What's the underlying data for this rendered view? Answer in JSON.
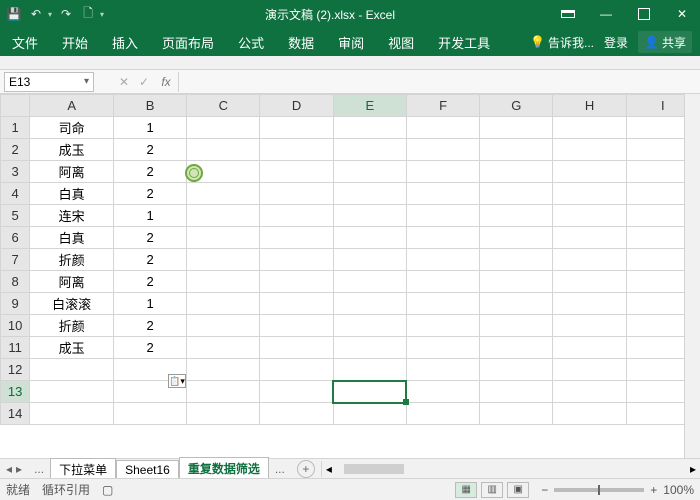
{
  "window": {
    "title": "演示文稿 (2).xlsx - Excel"
  },
  "qat": {
    "save": "💾",
    "undo": "↶",
    "redo": "↷",
    "new": "🗋"
  },
  "tabs": {
    "file": "文件",
    "home": "开始",
    "insert": "插入",
    "layout": "页面布局",
    "formulas": "公式",
    "data": "数据",
    "review": "审阅",
    "view": "视图",
    "dev": "开发工具",
    "tell": "告诉我...",
    "login": "登录",
    "share": "共享"
  },
  "namebox": "E13",
  "fx_label": "fx",
  "columns": [
    "A",
    "B",
    "C",
    "D",
    "E",
    "F",
    "G",
    "H",
    "I"
  ],
  "rows": [
    {
      "n": "1",
      "A": "司命",
      "B": "1"
    },
    {
      "n": "2",
      "A": "成玉",
      "B": "2"
    },
    {
      "n": "3",
      "A": "阿离",
      "B": "2"
    },
    {
      "n": "4",
      "A": "白真",
      "B": "2"
    },
    {
      "n": "5",
      "A": "连宋",
      "B": "1"
    },
    {
      "n": "6",
      "A": "白真",
      "B": "2"
    },
    {
      "n": "7",
      "A": "折颜",
      "B": "2"
    },
    {
      "n": "8",
      "A": "阿离",
      "B": "2"
    },
    {
      "n": "9",
      "A": "白滚滚",
      "B": "1"
    },
    {
      "n": "10",
      "A": "折颜",
      "B": "2"
    },
    {
      "n": "11",
      "A": "成玉",
      "B": "2"
    },
    {
      "n": "12",
      "A": "",
      "B": ""
    },
    {
      "n": "13",
      "A": "",
      "B": ""
    },
    {
      "n": "14",
      "A": "",
      "B": ""
    }
  ],
  "sheet_tabs": {
    "prev": "...",
    "t1": "下拉菜单",
    "t2": "Sheet16",
    "t3": "重复数据筛选",
    "next": "..."
  },
  "status": {
    "ready": "就绪",
    "circ": "循环引用",
    "zoom": "100%"
  },
  "selected_cell": "E13"
}
